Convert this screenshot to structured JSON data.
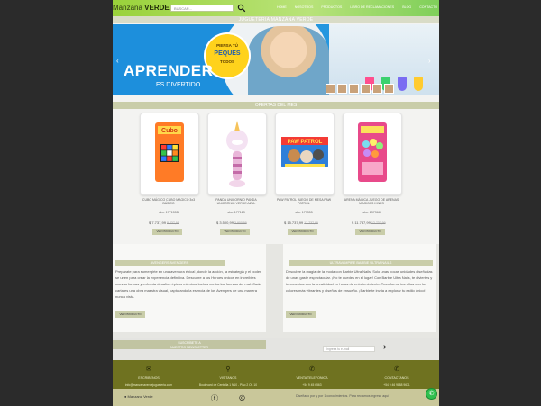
{
  "header": {
    "logo_a": "Manzana",
    "logo_b": "VERDE",
    "search_placeholder": "BUSCAR...",
    "nav": [
      "HOME",
      "NOSOTROS",
      "PRODUCTOS",
      "LIBRO DE RECLAMACIONES",
      "BLOG",
      "CONTACTO"
    ]
  },
  "banner": {
    "title": "JUGUETERIA MANZANA VERDE",
    "badge_l1": "PIENSA TÚ",
    "badge_l2": "PEQUES",
    "badge_l3": "TODOS",
    "headline": "APRENDER",
    "subline": "ES DIVERTIDO"
  },
  "offers": {
    "title": "OFERTAS DEL MES",
    "products": [
      {
        "name": "CUBO MÁGICO CUBO MAGICO 3x3 BÁSICO",
        "sku": "sku: 177155B",
        "price": "7.737,99",
        "old": "8.437,99",
        "button": "VER PRODUCTO",
        "color": "#ff7b26"
      },
      {
        "name": "PANDA UNICORNIO PANDA UNICORNIO VERDE AZUL",
        "sku": "sku: 177123",
        "price": "3.500,99",
        "old": "3.900,99",
        "button": "VER PRODUCTO",
        "color": "#f1d0ee"
      },
      {
        "name": "PAW PATROL JUEGO DE MESA PAW PATROL",
        "sku": "sku: 177355",
        "price": "15.737,99",
        "old": "17.737,99",
        "button": "VER PRODUCTO",
        "color": "#3a8fe0"
      },
      {
        "name": "ARENA MÁGICA JUEGO DE ARENAS MAGICAS KINES",
        "sku": "sku: 237368",
        "price": "11.737,99",
        "old": "12.737,99",
        "button": "VER PRODUCTO",
        "color": "#e84a8a"
      }
    ]
  },
  "boxes": [
    {
      "title": "AVENGERS AVENGERS",
      "text": "Prepárate para sumergirte en una aventura épica!, donde la acción, la estrategia y el poder se unen para crear la experiencia definitiva. Descubre a los Héroes únicos en increíbles nuevas formas y enfrenta desafíos épicos mientras luchas contra las fuerzas del mal. Cada carta es una obra maestra visual, capturando la esencia de los Avengers de una manera nunca vista.",
      "button": "VER PRODUCTO"
    },
    {
      "title": "ULTRAVAMPIRE BARBIE ULTRA NAILS",
      "text": "Descubre la magia de la moda con Barbie Ultra Nails. Solo unas pocas unidades diseñadas de unas gaste espectacular. ¡No te quedes en el lugar! Con Barbie Ultra Nails, te diviertes y te conectas con la creatividad en horas de entretenimiento. Transforma tus uñas con los colores más vibrantes y diseños de ensueño. ¡Barbie te invita a explorar tu estilo único!",
      "button": "VER PRODUCTO"
    }
  ],
  "newsletter": {
    "line1": "SUSCRÍBETE A",
    "line2": "NUESTRO NEWSLETTER",
    "placeholder": "Ingresa tu e-mail"
  },
  "footer": {
    "items": [
      {
        "icon": "envelope-icon",
        "label": "ESCRIBENOS",
        "value": "info@manzanaverdejugueteria.com"
      },
      {
        "icon": "location-icon",
        "label": "VISITANOS",
        "value": "Boulevard de Centella 1 N10 - Piso 2 Of. 10"
      },
      {
        "icon": "phone-icon",
        "label": "VENTA TELEFONICA",
        "value": "+54 9 45 6563"
      },
      {
        "icon": "phone-icon",
        "label": "CONTACTANOS",
        "value": "+54 9 46 9888 9671"
      }
    ],
    "brand": "Manzana Verde",
    "copyright": "Diseñado por y por 1 conocimientos. Para reclamos ingrese aquí"
  }
}
